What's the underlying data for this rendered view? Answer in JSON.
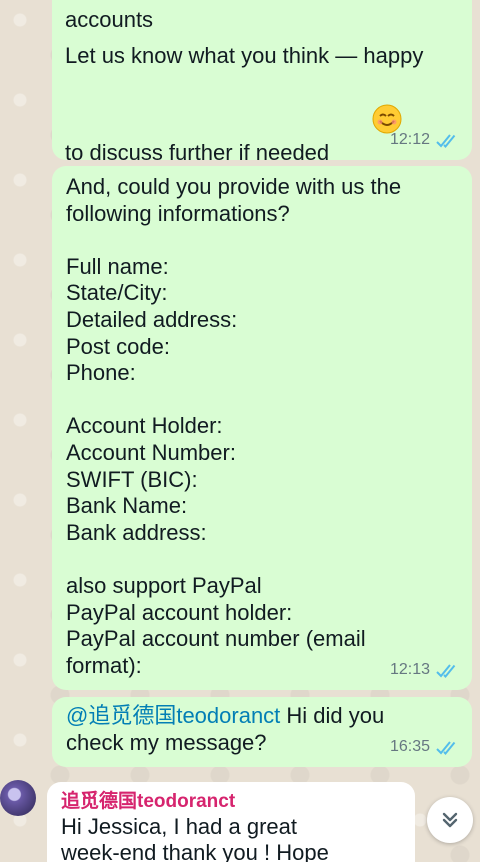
{
  "messages": [
    {
      "lines_a": "- Co-creation with local DREAME\naccounts",
      "lines_b": "Let us know what you think — happy\nto discuss further if needed",
      "emoji": "smiling-face-emoji",
      "time": "12:12"
    },
    {
      "text": "And, could you provide with us the\nfollowing informations?\n\nFull name:\nState/City:\nDetailed address:\nPost code:\nPhone:\n\nAccount Holder:\nAccount Number:\nSWIFT (BIC):\nBank Name:\nBank address:\n\nalso support PayPal\nPayPal account holder:\nPayPal account number (email\nformat):",
      "time": "12:13"
    },
    {
      "mention": "@追觅德国teodoranct",
      "text": " Hi did you\ncheck my message?",
      "time": "16:35"
    }
  ],
  "incoming": {
    "sender": "追觅德国teodoranct",
    "text": "Hi Jessica, I had a great\nweek-end thank you ! Hope"
  },
  "icons": {
    "read_receipt": "double-check-icon",
    "scroll_down": "double-chevron-down-icon",
    "avatar": "avatar"
  },
  "colors": {
    "outgoing_bubble": "#d9fdd3",
    "incoming_bubble": "#ffffff",
    "read_tick": "#53bdeb",
    "sender_name": "#d6246e",
    "mention": "#027eb5"
  }
}
